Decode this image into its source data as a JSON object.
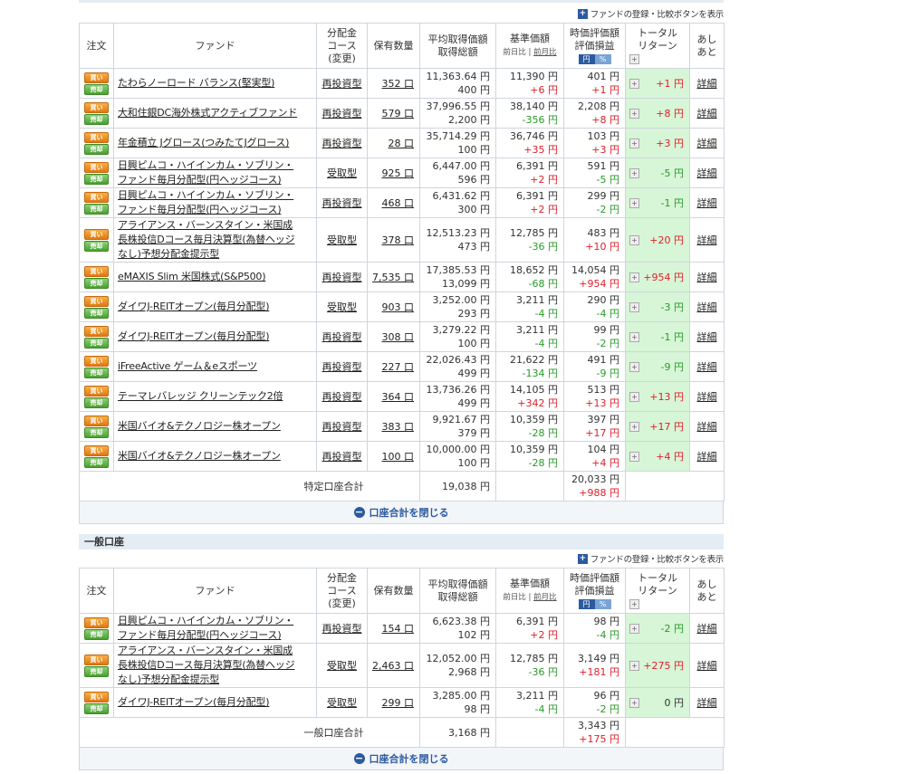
{
  "toolbar_text": "ファンドの登録・比較ボタンを表示",
  "headers": {
    "order": "注文",
    "fund": "ファンド",
    "course_l1": "分配金",
    "course_l2": "コース",
    "course_l3": "(変更)",
    "qty": "保有数量",
    "avg_l1": "平均取得価額",
    "avg_l2": "取得総額",
    "base_l1": "基準価額",
    "base_prev_day": "前日比",
    "base_prev_month": "前月比",
    "val_l1": "時価評価額",
    "val_l2": "評価損益",
    "yen": "円",
    "pct": "%",
    "total_l1": "トータル",
    "total_l2": "リターン",
    "trend_l1": "あし",
    "trend_l2": "あと"
  },
  "buy_label": "買い",
  "sell_label": "売却",
  "detail_label": "詳細",
  "close_label": "口座合計を閉じる",
  "section2_title": "一般口座",
  "colors": {
    "red": "#e0202a",
    "green": "#2a9a2a",
    "total_return_bg": "#d7f5d7",
    "accent": "#2c5aa0"
  },
  "tokutei": {
    "rows": [
      {
        "fund_lines": [
          "たわらノーロード バランス(堅実型)"
        ],
        "course": "再投資型",
        "qty": "352 口",
        "avg": "11,363.64 円",
        "total_cost": "400 円",
        "base": "11,390 円",
        "base_diff": "+6 円",
        "val": "401 円",
        "pl": "+1 円",
        "tr": "+1 円"
      },
      {
        "fund_lines": [
          "大和住銀DC海外株式アクティブファンド"
        ],
        "course": "再投資型",
        "qty": "579 口",
        "avg": "37,996.55 円",
        "total_cost": "2,200 円",
        "base": "38,140 円",
        "base_diff": "-356 円",
        "val": "2,208 円",
        "pl": "+8 円",
        "tr": "+8 円"
      },
      {
        "fund_lines": [
          "年金積立 Jグロース(つみたてJグロース)"
        ],
        "course": "再投資型",
        "qty": "28 口",
        "avg": "35,714.29 円",
        "total_cost": "100 円",
        "base": "36,746 円",
        "base_diff": "+35 円",
        "val": "103 円",
        "pl": "+3 円",
        "tr": "+3 円"
      },
      {
        "fund_lines": [
          "日興ピムコ・ハイインカム・ソブリン・",
          "ファンド毎月分配型(円ヘッジコース)"
        ],
        "course": "受取型",
        "qty": "925 口",
        "avg": "6,447.00 円",
        "total_cost": "596 円",
        "base": "6,391 円",
        "base_diff": "+2 円",
        "val": "591 円",
        "pl": "-5 円",
        "tr": "-5 円"
      },
      {
        "fund_lines": [
          "日興ピムコ・ハイインカム・ソブリン・",
          "ファンド毎月分配型(円ヘッジコース)"
        ],
        "course": "再投資型",
        "qty": "468 口",
        "avg": "6,431.62 円",
        "total_cost": "300 円",
        "base": "6,391 円",
        "base_diff": "+2 円",
        "val": "299 円",
        "pl": "-2 円",
        "tr": "-1 円"
      },
      {
        "fund_lines": [
          "アライアンス・バーンスタイン・米国成",
          "長株投信Dコース毎月決算型(為替ヘッジ",
          "なし)予想分配金提示型"
        ],
        "course": "受取型",
        "qty": "378 口",
        "avg": "12,513.23 円",
        "total_cost": "473 円",
        "base": "12,785 円",
        "base_diff": "-36 円",
        "val": "483 円",
        "pl": "+10 円",
        "tr": "+20 円"
      },
      {
        "fund_lines": [
          "eMAXIS Slim 米国株式(S&P500)"
        ],
        "course": "再投資型",
        "qty": "7,535 口",
        "avg": "17,385.53 円",
        "total_cost": "13,099 円",
        "base": "18,652 円",
        "base_diff": "-68 円",
        "val": "14,054 円",
        "pl": "+954 円",
        "tr": "+954 円"
      },
      {
        "fund_lines": [
          "ダイワJ-REITオープン(毎月分配型)"
        ],
        "course": "受取型",
        "qty": "903 口",
        "avg": "3,252.00 円",
        "total_cost": "293 円",
        "base": "3,211 円",
        "base_diff": "-4 円",
        "val": "290 円",
        "pl": "-4 円",
        "tr": "-3 円"
      },
      {
        "fund_lines": [
          "ダイワJ-REITオープン(毎月分配型)"
        ],
        "course": "再投資型",
        "qty": "308 口",
        "avg": "3,279.22 円",
        "total_cost": "100 円",
        "base": "3,211 円",
        "base_diff": "-4 円",
        "val": "99 円",
        "pl": "-2 円",
        "tr": "-1 円"
      },
      {
        "fund_lines": [
          "iFreeActive ゲーム＆eスポーツ"
        ],
        "course": "再投資型",
        "qty": "227 口",
        "avg": "22,026.43 円",
        "total_cost": "499 円",
        "base": "21,622 円",
        "base_diff": "-134 円",
        "val": "491 円",
        "pl": "-9 円",
        "tr": "-9 円"
      },
      {
        "fund_lines": [
          "テーマレバレッジ クリーンテック2倍"
        ],
        "course": "再投資型",
        "qty": "364 口",
        "avg": "13,736.26 円",
        "total_cost": "499 円",
        "base": "14,105 円",
        "base_diff": "+342 円",
        "val": "513 円",
        "pl": "+13 円",
        "tr": "+13 円"
      },
      {
        "fund_lines": [
          "米国バイオ&テクノロジー株オープン"
        ],
        "course": "再投資型",
        "qty": "383 口",
        "avg": "9,921.67 円",
        "total_cost": "379 円",
        "base": "10,359 円",
        "base_diff": "-28 円",
        "val": "397 円",
        "pl": "+17 円",
        "tr": "+17 円"
      },
      {
        "fund_lines": [
          "米国バイオ&テクノロジー株オープン"
        ],
        "course": "再投資型",
        "qty": "100 口",
        "avg": "10,000.00 円",
        "total_cost": "100 円",
        "base": "10,359 円",
        "base_diff": "-28 円",
        "val": "104 円",
        "pl": "+4 円",
        "tr": "+4 円"
      }
    ],
    "sum_label": "特定口座合計",
    "sum_cost": "19,038 円",
    "sum_val": "20,033 円",
    "sum_pl": "+988 円"
  },
  "ippan": {
    "rows": [
      {
        "fund_lines": [
          "日興ピムコ・ハイインカム・ソブリン・",
          "ファンド毎月分配型(円ヘッジコース)"
        ],
        "course": "再投資型",
        "qty": "154 口",
        "avg": "6,623.38 円",
        "total_cost": "102 円",
        "base": "6,391 円",
        "base_diff": "+2 円",
        "val": "98 円",
        "pl": "-4 円",
        "tr": "-2 円"
      },
      {
        "fund_lines": [
          "アライアンス・バーンスタイン・米国成",
          "長株投信Dコース毎月決算型(為替ヘッジ",
          "なし)予想分配金提示型"
        ],
        "course": "受取型",
        "qty": "2,463 口",
        "avg": "12,052.00 円",
        "total_cost": "2,968 円",
        "base": "12,785 円",
        "base_diff": "-36 円",
        "val": "3,149 円",
        "pl": "+181 円",
        "tr": "+275 円"
      },
      {
        "fund_lines": [
          "ダイワJ-REITオープン(毎月分配型)"
        ],
        "course": "受取型",
        "qty": "299 口",
        "avg": "3,285.00 円",
        "total_cost": "98 円",
        "base": "3,211 円",
        "base_diff": "-4 円",
        "val": "96 円",
        "pl": "-2 円",
        "tr": "0 円"
      }
    ],
    "sum_label": "一般口座合計",
    "sum_cost": "3,168 円",
    "sum_val": "3,343 円",
    "sum_pl": "+175 円"
  }
}
